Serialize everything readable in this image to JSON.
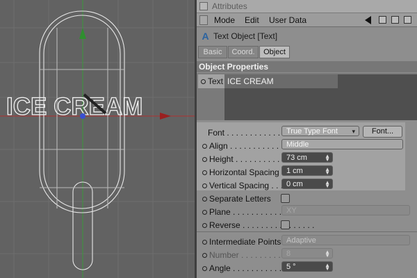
{
  "attributes": {
    "title": "Attributes",
    "menu": [
      "Mode",
      "Edit",
      "User Data"
    ],
    "object_name": "Text Object [Text]",
    "tabs": [
      "Basic",
      "Coord.",
      "Object"
    ],
    "active_tab": "Object",
    "section": "Object Properties",
    "text_label": "Text",
    "text_value": "ICE CREAM"
  },
  "properties": {
    "font_label": "Font",
    "font_value": "True Type Font",
    "font_button": "Font...",
    "align_label": "Align",
    "align_value": "Middle",
    "height_label": "Height",
    "height_value": "73 cm",
    "hspacing_label": "Horizontal Spacing",
    "hspacing_value": "1 cm",
    "vspacing_label": "Vertical Spacing",
    "vspacing_value": "0 cm",
    "separate_label": "Separate Letters",
    "plane_label": "Plane",
    "plane_value": "XY",
    "reverse_label": "Reverse",
    "interp_label": "Intermediate Points",
    "interp_value": "Adaptive",
    "number_label": "Number",
    "number_value": "8",
    "angle_label": "Angle",
    "angle_value": "5 °"
  },
  "viewport": {
    "scene_text": "ICE CREAM"
  }
}
